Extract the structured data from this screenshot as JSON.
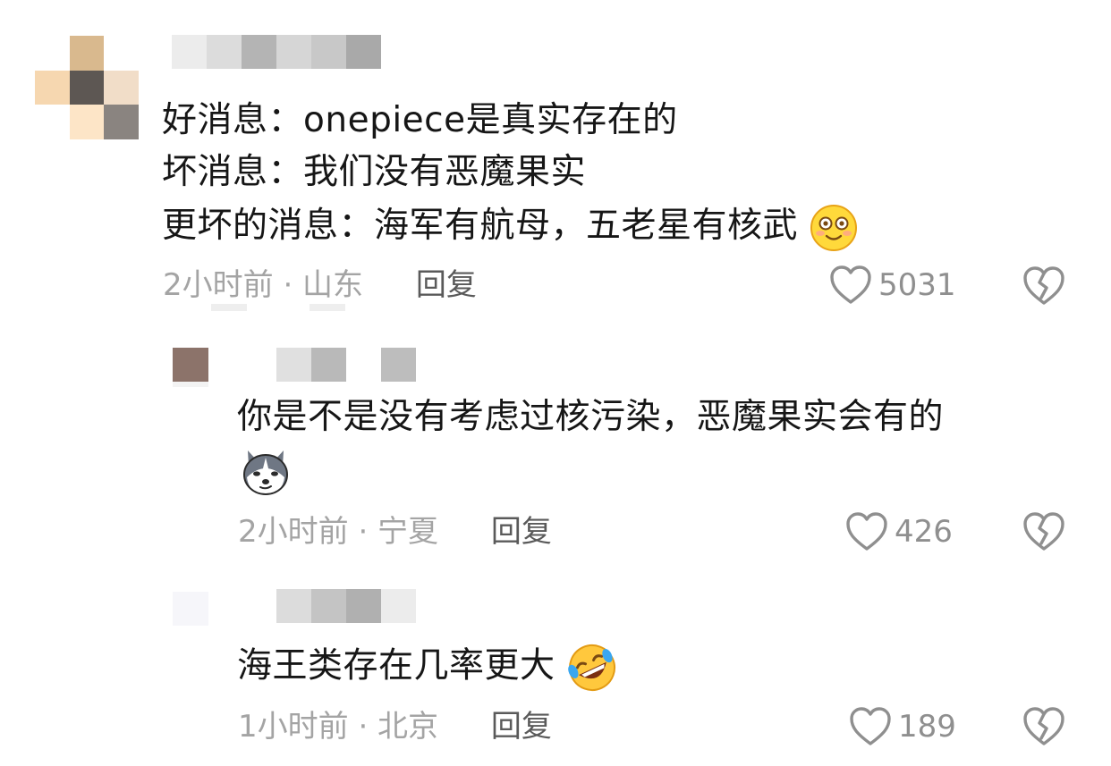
{
  "comments": [
    {
      "lines": [
        "好消息：onepiece是真实存在的",
        "坏消息：我们没有恶魔果实",
        "更坏的消息：海军有航母，五老星有核武"
      ],
      "time_location": "2小时前 · 山东",
      "reply_label": "回复",
      "likes": "5031",
      "emoji_icon": "smiling-face-emoji"
    },
    {
      "lines": [
        "你是不是没有考虑过核污染，恶魔果实会有的"
      ],
      "time_location": "2小时前 · 宁夏",
      "reply_label": "回复",
      "likes": "426",
      "emoji_icon": "husky-dog-emoji"
    },
    {
      "lines": [
        "海王类存在几率更大"
      ],
      "time_location": "1小时前 · 北京",
      "reply_label": "回复",
      "likes": "189",
      "emoji_icon": "rolling-laughing-emoji"
    }
  ],
  "colors": {
    "text": "#161616",
    "meta": "#a4a4a4",
    "reply": "#5a5a5a",
    "icon": "#8f8f8f"
  }
}
